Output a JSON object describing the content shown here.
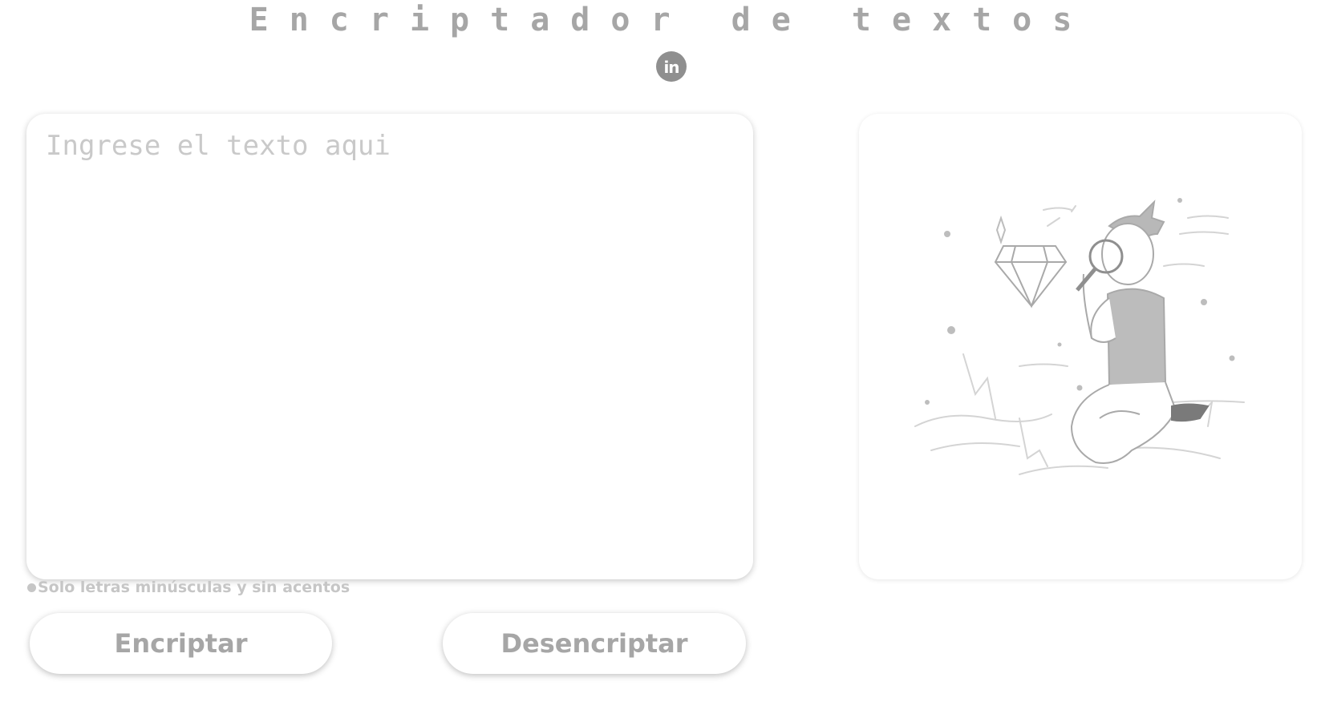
{
  "header": {
    "title": "Encriptador de textos",
    "linkedin_label": "in"
  },
  "input": {
    "placeholder": "Ingrese el texto aqui",
    "value": ""
  },
  "hint": {
    "text": "Solo letras minúsculas y sin acentos"
  },
  "buttons": {
    "encrypt_label": "Encriptar",
    "decrypt_label": "Desencriptar"
  },
  "result": {
    "illustration_icon": "person-with-magnifying-glass-icon"
  },
  "colors": {
    "text_gray": "#a6a6a6",
    "placeholder_gray": "#c9c9c9",
    "linkedin_gray": "#8f8f8f",
    "background": "#ffffff"
  }
}
